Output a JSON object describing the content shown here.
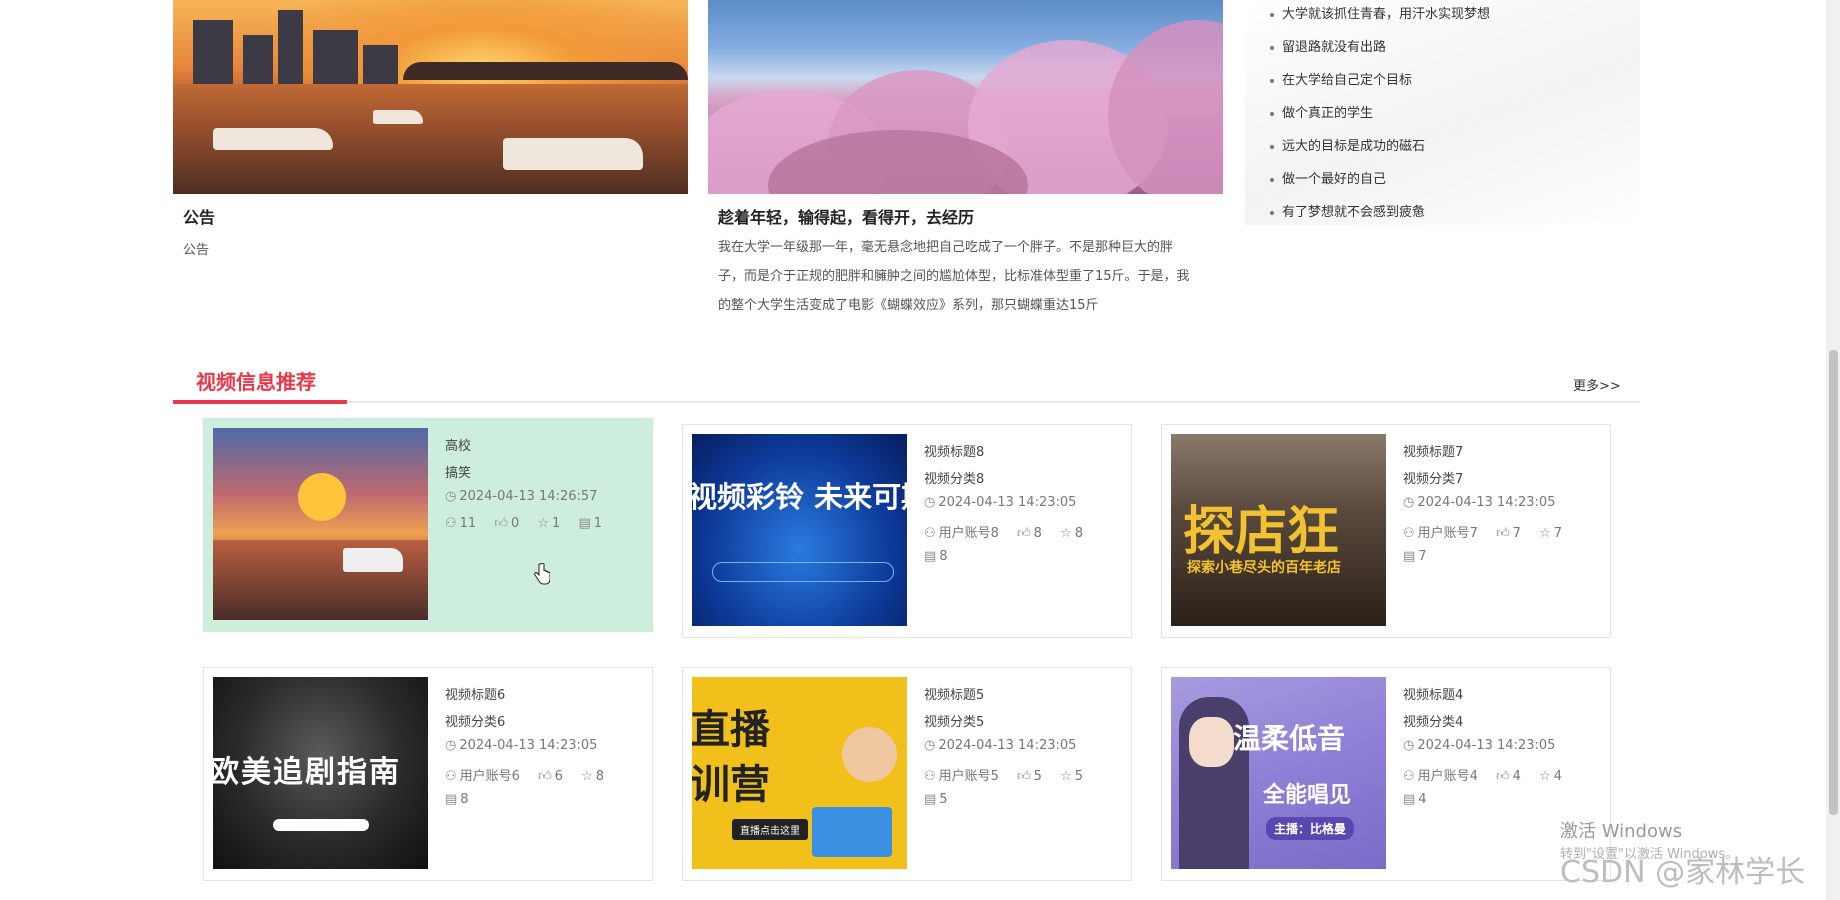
{
  "top_cards": [
    {
      "title": "公告",
      "subtitle": "公告"
    },
    {
      "title": "趁着年轻，输得起，看得开，去经历",
      "desc_lines": [
        "我在大学一年级那一年，毫无悬念地把自己吃成了一个胖子。不是那种巨大的胖",
        "子，而是介于正规的肥胖和臃肿之间的尴尬体型，比标准体型重了15斤。于是，我",
        "的整个大学生活变成了电影《蝴蝶效应》系列，那只蝴蝶重达15斤"
      ]
    }
  ],
  "mottos": [
    "大学就该抓住青春，用汗水实现梦想",
    "留退路就没有出路",
    "在大学给自己定个目标",
    "做个真正的学生",
    "远大的目标是成功的磁石",
    "做一个最好的自己",
    "有了梦想就不会感到疲惫"
  ],
  "section": {
    "title": "视频信息推荐",
    "more": "更多>>"
  },
  "videos": [
    {
      "title": "高校",
      "category": "搞笑",
      "time": "2024-04-13 14:26:57",
      "user": "11",
      "likes": "0",
      "favs": "1",
      "comments": "1"
    },
    {
      "title": "视频标题8",
      "category": "视频分类8",
      "time": "2024-04-13 14:23:05",
      "user": "用户账号8",
      "likes": "8",
      "favs": "8",
      "comments": "8",
      "thumb_text": "视频彩铃 未来可期"
    },
    {
      "title": "视频标题7",
      "category": "视频分类7",
      "time": "2024-04-13 14:23:05",
      "user": "用户账号7",
      "likes": "7",
      "favs": "7",
      "comments": "7",
      "thumb_text": "探店狂",
      "thumb_sub": "探索小巷尽头的百年老店"
    },
    {
      "title": "视频标题6",
      "category": "视频分类6",
      "time": "2024-04-13 14:23:05",
      "user": "用户账号6",
      "likes": "6",
      "favs": "8",
      "comments": "8",
      "thumb_text": "欧美追剧指南"
    },
    {
      "title": "视频标题5",
      "category": "视频分类5",
      "time": "2024-04-13 14:23:05",
      "user": "用户账号5",
      "likes": "5",
      "favs": "5",
      "comments": "5",
      "thumb_text": "直播",
      "thumb_text2": "训营",
      "thumb_btn": "直播点击这里"
    },
    {
      "title": "视频标题4",
      "category": "视频分类4",
      "time": "2024-04-13 14:23:05",
      "user": "用户账号4",
      "likes": "4",
      "favs": "4",
      "comments": "4",
      "thumb_text": "温柔低音",
      "thumb_text2": "全能唱见",
      "thumb_sub": "主播：比格曼"
    }
  ],
  "watermark": {
    "windows": "激活 Windows",
    "windows_sub": "转到\"设置\"以激活 Windows。",
    "csdn": "CSDN @家林学长"
  },
  "colors": {
    "accent": "#e8394b",
    "highlight_card": "#cdeedd"
  }
}
